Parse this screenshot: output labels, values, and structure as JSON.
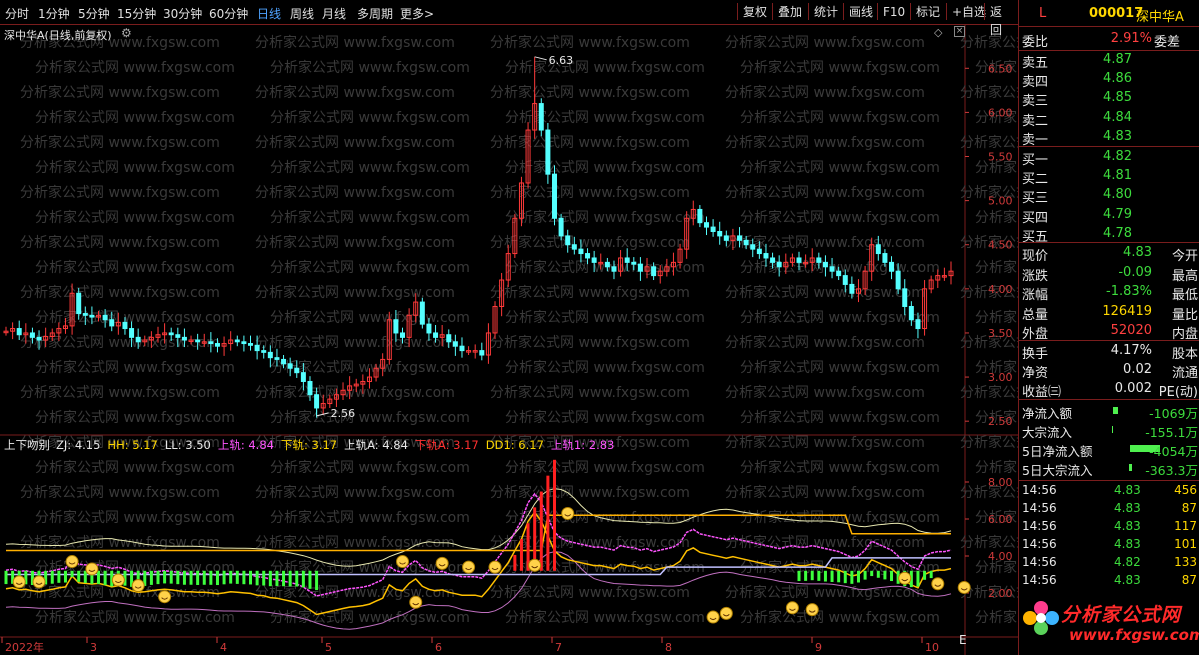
{
  "toolbar": {
    "tabs": [
      {
        "label": "分时",
        "active": false
      },
      {
        "label": "1分钟",
        "active": false
      },
      {
        "label": "5分钟",
        "active": false
      },
      {
        "label": "15分钟",
        "active": false
      },
      {
        "label": "30分钟",
        "active": false
      },
      {
        "label": "60分钟",
        "active": false
      },
      {
        "label": "日线",
        "active": true
      },
      {
        "label": "周线",
        "active": false
      },
      {
        "label": "月线",
        "active": false
      },
      {
        "label": "多周期",
        "active": false
      },
      {
        "label": "更多>",
        "active": false
      }
    ],
    "buttons": [
      "复权",
      "叠加",
      "统计",
      "画线",
      "F10",
      "标记",
      "+自选",
      "返回"
    ]
  },
  "watermark": "分析家公式网 www.fxgsw.com",
  "chart_data": [
    {
      "type": "candlestick",
      "title": "深中华A(日线,前复权)",
      "y_ticks": [
        "6.50",
        "6.00",
        "5.50",
        "5.00",
        "4.50",
        "4.00",
        "3.50",
        "3.00",
        "2.50"
      ],
      "ylim": [
        2.4,
        6.9
      ],
      "high_label": "6.63",
      "low_label": "2.56",
      "series": [
        {
          "values": [
            3.52,
            3.55,
            3.48,
            3.5,
            3.45,
            3.42,
            3.46,
            3.5,
            3.55,
            3.58,
            3.95,
            3.72,
            3.7,
            3.68,
            3.7,
            3.65,
            3.58,
            3.62,
            3.55,
            3.45,
            3.4,
            3.42,
            3.45,
            3.48,
            3.5,
            3.48,
            3.45,
            3.42,
            3.42,
            3.4,
            3.4,
            3.38,
            3.35,
            3.38,
            3.42,
            3.4,
            3.38,
            3.36,
            3.3,
            3.28,
            3.22,
            3.2,
            3.15,
            3.1,
            3.05,
            2.95,
            2.8,
            2.65,
            2.7,
            2.75,
            2.8,
            2.85,
            2.9,
            2.92,
            2.95,
            3.0,
            3.1,
            3.2,
            3.65,
            3.5,
            3.45,
            3.7,
            3.85,
            3.6,
            3.5,
            3.45,
            3.48,
            3.4,
            3.35,
            3.3,
            3.3,
            3.3,
            3.25,
            3.5,
            3.8,
            4.1,
            4.4,
            4.8,
            5.2,
            5.8,
            6.1,
            5.8,
            5.3,
            4.8,
            4.6,
            4.5,
            4.45,
            4.4,
            4.35,
            4.3,
            4.3,
            4.25,
            4.2,
            4.35,
            4.3,
            4.28,
            4.2,
            4.25,
            4.15,
            4.2,
            4.25,
            4.3,
            4.45,
            4.8,
            4.9,
            4.75,
            4.7,
            4.65,
            4.6,
            4.55,
            4.6,
            4.55,
            4.5,
            4.45,
            4.4,
            4.35,
            4.3,
            4.25,
            4.3,
            4.35,
            4.3,
            4.3,
            4.35,
            4.3,
            4.25,
            4.2,
            4.15,
            4.05,
            3.95,
            4.0,
            4.2,
            4.5,
            4.4,
            4.3,
            4.2,
            4.0,
            3.8,
            3.65,
            3.55,
            4.0,
            4.1,
            4.15,
            4.15,
            4.2
          ]
        }
      ]
    },
    {
      "type": "line",
      "title": "上下吻别",
      "legend": [
        {
          "name": "ZJ",
          "value": "4.15",
          "color": "#e8e8e8"
        },
        {
          "name": "HH",
          "value": "5.17",
          "color": "#ffd700"
        },
        {
          "name": "LL",
          "value": "3.50",
          "color": "#e8e8e8"
        },
        {
          "name": "上轨",
          "value": "4.84",
          "color": "#ff55ff"
        },
        {
          "name": "下轨",
          "value": "3.17",
          "color": "#ffd700"
        },
        {
          "name": "上轨A",
          "value": "4.84",
          "color": "#e8e8e8"
        },
        {
          "name": "下轨A",
          "value": "3.17",
          "color": "#ff3030"
        },
        {
          "name": "DD1",
          "value": "6.17",
          "color": "#ffd700"
        },
        {
          "name": "上轨1",
          "value": "2.83",
          "color": "#ff55ff"
        }
      ],
      "y_ticks": [
        "8.00",
        "6.00",
        "4.00",
        "2.00"
      ],
      "ylim": [
        0,
        10
      ],
      "x_labels": [
        "2022年",
        "3",
        "4",
        "5",
        "6",
        "7",
        "8",
        "9",
        "10"
      ]
    }
  ],
  "quote": {
    "code": "000017",
    "name": "深中华A",
    "flag": "L",
    "wei": {
      "k1": "委比",
      "v": "2.91%",
      "k2": "委差"
    },
    "asks": [
      {
        "k": "卖五",
        "v": "4.87"
      },
      {
        "k": "卖四",
        "v": "4.86"
      },
      {
        "k": "卖三",
        "v": "4.85"
      },
      {
        "k": "卖二",
        "v": "4.84"
      },
      {
        "k": "卖一",
        "v": "4.83"
      }
    ],
    "bids": [
      {
        "k": "买一",
        "v": "4.82"
      },
      {
        "k": "买二",
        "v": "4.81"
      },
      {
        "k": "买三",
        "v": "4.80"
      },
      {
        "k": "买四",
        "v": "4.79"
      },
      {
        "k": "买五",
        "v": "4.78"
      }
    ],
    "stats": [
      {
        "k": "现价",
        "v": "4.83",
        "k2": "今开",
        "c": "green"
      },
      {
        "k": "涨跌",
        "v": "-0.09",
        "k2": "最高",
        "c": "green"
      },
      {
        "k": "涨幅",
        "v": "-1.83%",
        "k2": "最低",
        "c": "green"
      },
      {
        "k": "总量",
        "v": "126419",
        "k2": "量比",
        "c": "yellow"
      },
      {
        "k": "外盘",
        "v": "52020",
        "k2": "内盘",
        "c": "red"
      }
    ],
    "stats2": [
      {
        "k": "换手",
        "v": "4.17%",
        "k2": "股本",
        "c": "white"
      },
      {
        "k": "净资",
        "v": "0.02",
        "k2": "流通",
        "c": "white"
      },
      {
        "k": "收益㈢",
        "v": "0.002",
        "k2": "PE(动)",
        "c": "white"
      }
    ],
    "flows": [
      {
        "k": "净流入额",
        "v": "-1069万",
        "bar": 0.06
      },
      {
        "k": "大宗流入",
        "v": "-155.1万",
        "bar": 0.01
      },
      {
        "k": "5日净流入额",
        "v": "-4054万",
        "bar": 0.5
      },
      {
        "k": "5日大宗流入",
        "v": "-363.3万",
        "bar": 0.05
      }
    ],
    "trades": [
      {
        "t": "14:56",
        "p": "4.83",
        "q": "456"
      },
      {
        "t": "14:56",
        "p": "4.83",
        "q": "87"
      },
      {
        "t": "14:56",
        "p": "4.83",
        "q": "117"
      },
      {
        "t": "14:56",
        "p": "4.83",
        "q": "101"
      },
      {
        "t": "14:56",
        "p": "4.82",
        "q": "133"
      },
      {
        "t": "14:56",
        "p": "4.83",
        "q": "87"
      }
    ],
    "logo": "分析家公式网",
    "logo_url": "www.fxgsw.com"
  }
}
